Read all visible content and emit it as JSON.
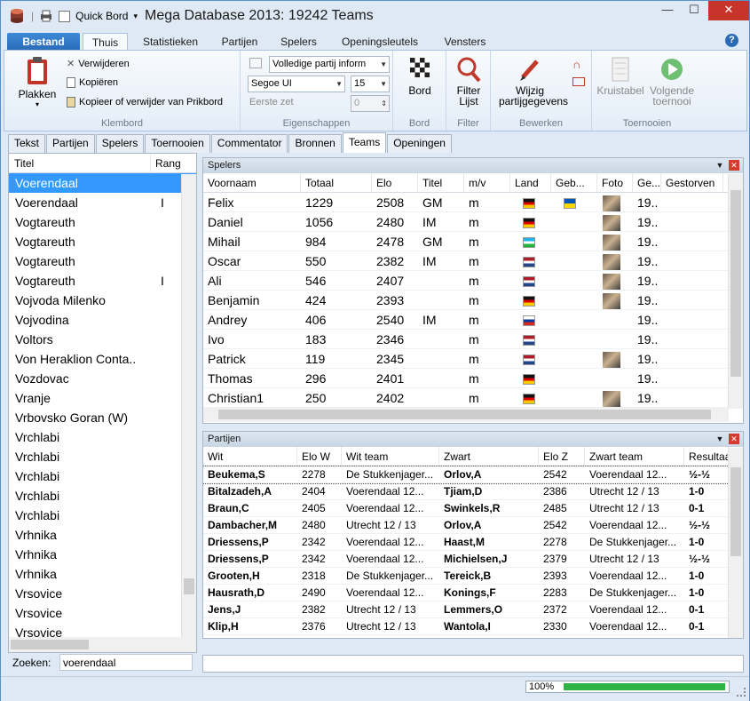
{
  "window": {
    "title": "Mega Database 2013:  19242 Teams"
  },
  "quickaccess": {
    "board_label": "Quick Bord"
  },
  "ribbon_tabs": [
    "Bestand",
    "Thuis",
    "Statistieken",
    "Partijen",
    "Spelers",
    "Openingsleutels",
    "Vensters"
  ],
  "ribbon": {
    "paste_label": "Plakken",
    "delete_label": "Verwijderen",
    "copy_label": "Kopiëren",
    "clipboard_label": "Kopieer of verwijder van Prikbord",
    "group_klembord": "Klembord",
    "display_combo": "Volledige partij inform",
    "font_combo": "Segoe UI",
    "size_combo": "15",
    "first_move_label": "Eerste zet",
    "first_move_value": "0",
    "group_props": "Eigenschappen",
    "board_label": "Bord",
    "group_board": "Bord",
    "filter_label": "Filter Lijst",
    "group_filter": "Filter",
    "edit_label": "Wijzig partijgegevens",
    "group_edit": "Bewerken",
    "crosstable_label": "Kruistabel",
    "next_label": "Volgende toernooi",
    "group_tournaments": "Toernooien"
  },
  "doc_tabs": [
    "Tekst",
    "Partijen",
    "Spelers",
    "Toernooien",
    "Commentator",
    "Bronnen",
    "Teams",
    "Openingen"
  ],
  "left": {
    "col_title": "Titel",
    "col_rank": "Rang",
    "rows": [
      {
        "t": "Voerendaal",
        "r": ""
      },
      {
        "t": "Voerendaal",
        "r": "I"
      },
      {
        "t": "Vogtareuth",
        "r": ""
      },
      {
        "t": "Vogtareuth",
        "r": ""
      },
      {
        "t": "Vogtareuth",
        "r": ""
      },
      {
        "t": "Vogtareuth",
        "r": "I"
      },
      {
        "t": "Vojvoda Milenko",
        "r": ""
      },
      {
        "t": "Vojvodina",
        "r": ""
      },
      {
        "t": "Voltors",
        "r": ""
      },
      {
        "t": "Von Heraklion Conta..",
        "r": ""
      },
      {
        "t": "Vozdovac",
        "r": ""
      },
      {
        "t": "Vranje",
        "r": ""
      },
      {
        "t": "Vrbovsko Goran (W)",
        "r": ""
      },
      {
        "t": "Vrchlabi",
        "r": ""
      },
      {
        "t": "Vrchlabi",
        "r": ""
      },
      {
        "t": "Vrchlabi",
        "r": ""
      },
      {
        "t": "Vrchlabi",
        "r": ""
      },
      {
        "t": "Vrchlabi",
        "r": ""
      },
      {
        "t": "Vrhnika",
        "r": ""
      },
      {
        "t": "Vrhnika",
        "r": ""
      },
      {
        "t": "Vrhnika",
        "r": ""
      },
      {
        "t": "Vrsovice",
        "r": ""
      },
      {
        "t": "Vrsovice",
        "r": ""
      },
      {
        "t": "Vrsovice",
        "r": ""
      }
    ],
    "search_label": "Zoeken:",
    "search_value": "voerendaal"
  },
  "players_panel": {
    "title": "Spelers",
    "headers": [
      "Voornaam",
      "Totaal",
      "Elo",
      "Titel",
      "m/v",
      "Land",
      "Geb...",
      "Foto",
      "Ge...",
      "Gestorven"
    ],
    "rows": [
      {
        "n": "Felix",
        "tot": "1229",
        "elo": "2508",
        "ti": "GM",
        "mv": "m",
        "flag": "de",
        "geb": "ua",
        "photo": true,
        "ge": "19.."
      },
      {
        "n": "Daniel",
        "tot": "1056",
        "elo": "2480",
        "ti": "IM",
        "mv": "m",
        "flag": "de",
        "geb": "",
        "photo": true,
        "ge": "19.."
      },
      {
        "n": "Mihail",
        "tot": "984",
        "elo": "2478",
        "ti": "GM",
        "mv": "m",
        "flag": "uz",
        "geb": "",
        "photo": true,
        "ge": "19.."
      },
      {
        "n": "Oscar",
        "tot": "550",
        "elo": "2382",
        "ti": "IM",
        "mv": "m",
        "flag": "nl",
        "geb": "",
        "photo": true,
        "ge": "19.."
      },
      {
        "n": "Ali",
        "tot": "546",
        "elo": "2407",
        "ti": "",
        "mv": "m",
        "flag": "nl",
        "geb": "",
        "photo": true,
        "ge": "19.."
      },
      {
        "n": "Benjamin",
        "tot": "424",
        "elo": "2393",
        "ti": "",
        "mv": "m",
        "flag": "de",
        "geb": "",
        "photo": true,
        "ge": "19.."
      },
      {
        "n": "Andrey",
        "tot": "406",
        "elo": "2540",
        "ti": "IM",
        "mv": "m",
        "flag": "ru",
        "geb": "",
        "photo": false,
        "ge": "19.."
      },
      {
        "n": "Ivo",
        "tot": "183",
        "elo": "2346",
        "ti": "",
        "mv": "m",
        "flag": "nl",
        "geb": "",
        "photo": false,
        "ge": "19.."
      },
      {
        "n": "Patrick",
        "tot": "119",
        "elo": "2345",
        "ti": "",
        "mv": "m",
        "flag": "nl",
        "geb": "",
        "photo": true,
        "ge": "19.."
      },
      {
        "n": "Thomas",
        "tot": "296",
        "elo": "2401",
        "ti": "",
        "mv": "m",
        "flag": "de",
        "geb": "",
        "photo": false,
        "ge": "19.."
      },
      {
        "n": "Christian1",
        "tot": "250",
        "elo": "2402",
        "ti": "",
        "mv": "m",
        "flag": "de",
        "geb": "",
        "photo": true,
        "ge": "19.."
      }
    ]
  },
  "games_panel": {
    "title": "Partijen",
    "headers": [
      "Wit",
      "Elo W",
      "Wit team",
      "Zwart",
      "Elo Z",
      "Zwart team",
      "Resultaat"
    ],
    "rows": [
      {
        "w": "Beukema,S",
        "ew": "2278",
        "wt": "De Stukkenjager...",
        "b": "Orlov,A",
        "eb": "2542",
        "bt": "Voerendaal     12...",
        "res": "½-½"
      },
      {
        "w": "Bitalzadeh,A",
        "ew": "2404",
        "wt": "Voerendaal     12...",
        "b": "Tjiam,D",
        "eb": "2386",
        "bt": "Utrecht     12 / 13",
        "res": "1-0"
      },
      {
        "w": "Braun,C",
        "ew": "2405",
        "wt": "Voerendaal     12...",
        "b": "Swinkels,R",
        "eb": "2485",
        "bt": "Utrecht     12 / 13",
        "res": "0-1"
      },
      {
        "w": "Dambacher,M",
        "ew": "2480",
        "wt": "Utrecht     12 / 13",
        "b": "Orlov,A",
        "eb": "2542",
        "bt": "Voerendaal     12...",
        "res": "½-½"
      },
      {
        "w": "Driessens,P",
        "ew": "2342",
        "wt": "Voerendaal     12...",
        "b": "Haast,M",
        "eb": "2278",
        "bt": "De Stukkenjager...",
        "res": "1-0"
      },
      {
        "w": "Driessens,P",
        "ew": "2342",
        "wt": "Voerendaal     12...",
        "b": "Michielsen,J",
        "eb": "2379",
        "bt": "Utrecht     12 / 13",
        "res": "½-½"
      },
      {
        "w": "Grooten,H",
        "ew": "2318",
        "wt": "De Stukkenjager...",
        "b": "Tereick,B",
        "eb": "2393",
        "bt": "Voerendaal     12...",
        "res": "1-0"
      },
      {
        "w": "Hausrath,D",
        "ew": "2490",
        "wt": "Voerendaal     12...",
        "b": "Konings,F",
        "eb": "2283",
        "bt": "De Stukkenjager...",
        "res": "1-0"
      },
      {
        "w": "Jens,J",
        "ew": "2382",
        "wt": "Utrecht     12 / 13",
        "b": "Lemmers,O",
        "eb": "2372",
        "bt": "Voerendaal     12...",
        "res": "0-1"
      },
      {
        "w": "Klip,H",
        "ew": "2376",
        "wt": "Utrecht     12 / 13",
        "b": "Wantola,I",
        "eb": "2330",
        "bt": "Voerendaal     12...",
        "res": "0-1"
      }
    ]
  },
  "status": {
    "progress_text": "100%",
    "progress": 1.0
  }
}
